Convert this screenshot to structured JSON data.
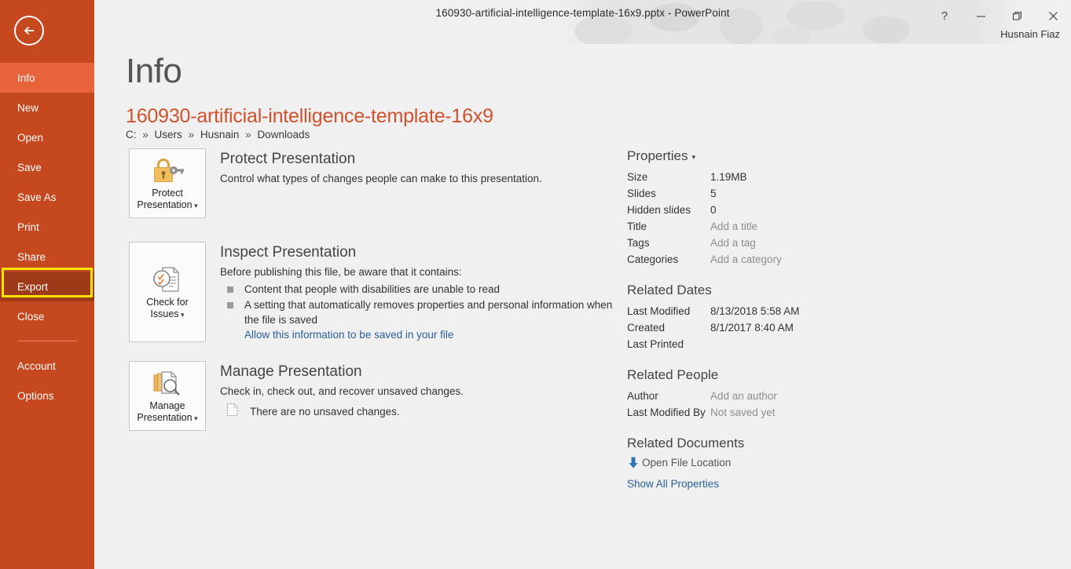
{
  "titlebar": {
    "title": "160930-artificial-intelligence-template-16x9.pptx - PowerPoint",
    "user_name": "Husnain Fiaz",
    "help_glyph": "?",
    "help_name": "help-button",
    "minimize_name": "minimize-button",
    "restore_name": "restore-button",
    "close_name": "close-button"
  },
  "sidebar": {
    "back_label": "Back",
    "accent_color": "#c6481e",
    "active_color": "#e8633a",
    "highlight_color": "#9e3a18",
    "highlight_border_color": "#ffe400",
    "items": [
      {
        "label": "Info",
        "state": "active"
      },
      {
        "label": "New",
        "state": "normal"
      },
      {
        "label": "Open",
        "state": "normal"
      },
      {
        "label": "Save",
        "state": "normal"
      },
      {
        "label": "Save As",
        "state": "normal"
      },
      {
        "label": "Print",
        "state": "normal"
      },
      {
        "label": "Share",
        "state": "normal"
      },
      {
        "label": "Export",
        "state": "highlighted"
      },
      {
        "label": "Close",
        "state": "normal"
      }
    ],
    "lower_items": [
      {
        "label": "Account"
      },
      {
        "label": "Options"
      }
    ]
  },
  "main": {
    "page_title": "Info",
    "file_name": "160930-artificial-intelligence-template-16x9",
    "file_name_color": "#d2512d",
    "breadcrumb": [
      "C:",
      "Users",
      "Husnain",
      "Downloads"
    ],
    "breadcrumb_separator": "»",
    "protect": {
      "button_label_line1": "Protect",
      "button_label_line2": "Presentation",
      "title": "Protect Presentation",
      "description": "Control what types of changes people can make to this presentation."
    },
    "inspect": {
      "button_label_line1": "Check for",
      "button_label_line2": "Issues",
      "title": "Inspect Presentation",
      "description": "Before publishing this file, be aware that it contains:",
      "bullets": [
        "Content that people with disabilities are unable to read",
        "A setting that automatically removes properties and personal information when the file is saved"
      ],
      "link": "Allow this information to be saved in your file",
      "link_color": "#2a6099"
    },
    "manage": {
      "button_label_line1": "Manage",
      "button_label_line2": "Presentation",
      "title": "Manage Presentation",
      "description": "Check in, check out, and recover unsaved changes.",
      "status": "There are no unsaved changes."
    }
  },
  "properties_panel": {
    "properties": {
      "heading": "Properties",
      "rows": [
        {
          "key": "Size",
          "value": "1.19MB",
          "placeholder": false
        },
        {
          "key": "Slides",
          "value": "5",
          "placeholder": false
        },
        {
          "key": "Hidden slides",
          "value": "0",
          "placeholder": false
        },
        {
          "key": "Title",
          "value": "Add a title",
          "placeholder": true
        },
        {
          "key": "Tags",
          "value": "Add a tag",
          "placeholder": true
        },
        {
          "key": "Categories",
          "value": "Add a category",
          "placeholder": true
        }
      ]
    },
    "related_dates": {
      "heading": "Related Dates",
      "rows": [
        {
          "key": "Last Modified",
          "value": "8/13/2018 5:58 AM",
          "placeholder": false
        },
        {
          "key": "Created",
          "value": "8/1/2017 8:40 AM",
          "placeholder": false
        },
        {
          "key": "Last Printed",
          "value": "",
          "placeholder": false
        }
      ]
    },
    "related_people": {
      "heading": "Related People",
      "rows": [
        {
          "key": "Author",
          "value": "Add an author",
          "placeholder": true
        },
        {
          "key": "Last Modified By",
          "value": "Not saved yet",
          "placeholder": true
        }
      ]
    },
    "related_documents": {
      "heading": "Related Documents",
      "open_file_location": "Open File Location",
      "show_all_properties": "Show All Properties",
      "link_color": "#2a6099",
      "arrow_color": "#2e75b6"
    }
  }
}
